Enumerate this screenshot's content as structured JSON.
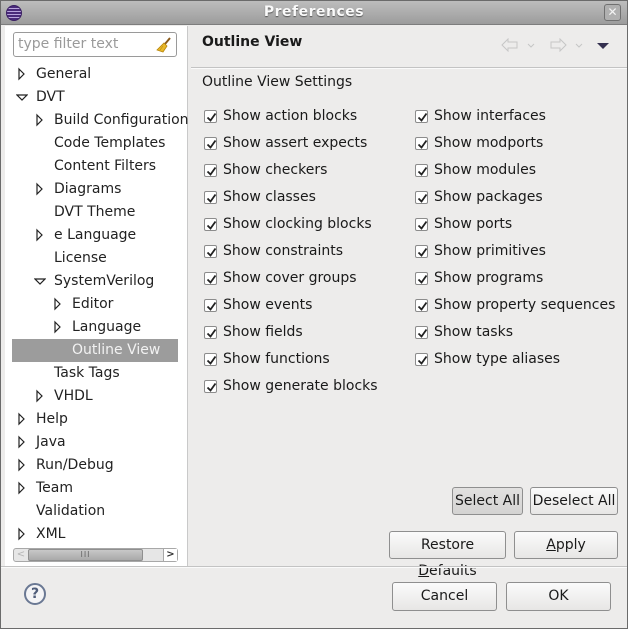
{
  "window": {
    "title": "Preferences",
    "close_icon": "close-icon",
    "app_icon": "eclipse-icon"
  },
  "filter": {
    "placeholder": "type filter text",
    "value": "",
    "clear_icon": "broom-icon"
  },
  "tree": [
    {
      "label": "General",
      "depth": 0,
      "expander": "collapsed"
    },
    {
      "label": "DVT",
      "depth": 0,
      "expander": "expanded"
    },
    {
      "label": "Build Configuration",
      "depth": 1,
      "expander": "collapsed"
    },
    {
      "label": "Code Templates",
      "depth": 1,
      "expander": "none"
    },
    {
      "label": "Content Filters",
      "depth": 1,
      "expander": "none"
    },
    {
      "label": "Diagrams",
      "depth": 1,
      "expander": "collapsed"
    },
    {
      "label": "DVT Theme",
      "depth": 1,
      "expander": "none"
    },
    {
      "label": "e Language",
      "depth": 1,
      "expander": "collapsed"
    },
    {
      "label": "License",
      "depth": 1,
      "expander": "none"
    },
    {
      "label": "SystemVerilog",
      "depth": 1,
      "expander": "expanded"
    },
    {
      "label": "Editor",
      "depth": 2,
      "expander": "collapsed"
    },
    {
      "label": "Language",
      "depth": 2,
      "expander": "collapsed"
    },
    {
      "label": "Outline View",
      "depth": 2,
      "expander": "none",
      "selected": true
    },
    {
      "label": "Task Tags",
      "depth": 1,
      "expander": "none"
    },
    {
      "label": "VHDL",
      "depth": 1,
      "expander": "collapsed"
    },
    {
      "label": "Help",
      "depth": 0,
      "expander": "collapsed"
    },
    {
      "label": "Java",
      "depth": 0,
      "expander": "collapsed"
    },
    {
      "label": "Run/Debug",
      "depth": 0,
      "expander": "collapsed"
    },
    {
      "label": "Team",
      "depth": 0,
      "expander": "collapsed"
    },
    {
      "label": "Validation",
      "depth": 0,
      "expander": "none"
    },
    {
      "label": "XML",
      "depth": 0,
      "expander": "collapsed"
    }
  ],
  "page": {
    "title": "Outline View",
    "section_label": "Outline View Settings",
    "nav": {
      "back_icon": "back-arrow-icon",
      "forward_icon": "forward-arrow-icon",
      "menu_icon": "view-menu-icon"
    },
    "left_options": [
      {
        "label": "Show action blocks",
        "checked": true
      },
      {
        "label": "Show assert expects",
        "checked": true
      },
      {
        "label": "Show checkers",
        "checked": true
      },
      {
        "label": "Show classes",
        "checked": true
      },
      {
        "label": "Show clocking blocks",
        "checked": true
      },
      {
        "label": "Show constraints",
        "checked": true
      },
      {
        "label": "Show cover groups",
        "checked": true
      },
      {
        "label": "Show events",
        "checked": true
      },
      {
        "label": "Show fields",
        "checked": true
      },
      {
        "label": "Show functions",
        "checked": true
      },
      {
        "label": "Show generate blocks",
        "checked": true
      }
    ],
    "right_options": [
      {
        "label": "Show interfaces",
        "checked": true
      },
      {
        "label": "Show modports",
        "checked": true
      },
      {
        "label": "Show modules",
        "checked": true
      },
      {
        "label": "Show packages",
        "checked": true
      },
      {
        "label": "Show ports",
        "checked": true
      },
      {
        "label": "Show primitives",
        "checked": true
      },
      {
        "label": "Show programs",
        "checked": true
      },
      {
        "label": "Show property sequences",
        "checked": true
      },
      {
        "label": "Show tasks",
        "checked": true
      },
      {
        "label": "Show type aliases",
        "checked": true
      }
    ],
    "buttons": {
      "select_all": "Select All",
      "deselect_all": "Deselect All",
      "restore_defaults_pre": "Restore ",
      "restore_defaults_mnemonic": "D",
      "restore_defaults_post": "efaults",
      "apply_mnemonic": "A",
      "apply_post": "pply"
    }
  },
  "footer": {
    "help_icon": "help-icon",
    "help_glyph": "?",
    "cancel": "Cancel",
    "ok": "OK"
  }
}
